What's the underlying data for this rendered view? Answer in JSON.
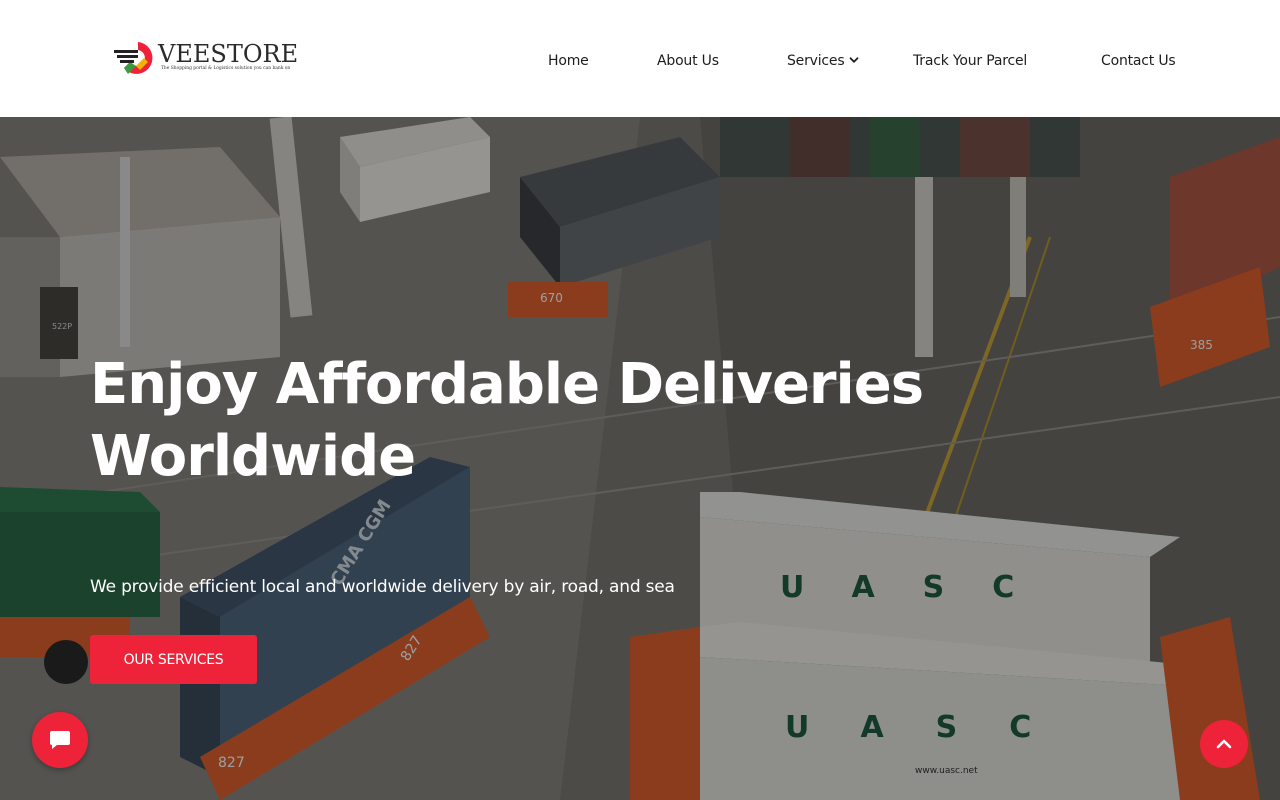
{
  "brand": {
    "name": "VEESTORE",
    "tagline": "The Shopping portal & Logistics solution you can bank on",
    "colors": {
      "red": "#ee2239",
      "dark": "#2b2b2b",
      "green": "#3c9a3c",
      "yellow": "#f2b400"
    }
  },
  "nav": {
    "home": "Home",
    "about": "About Us",
    "services": "Services",
    "track": "Track Your Parcel",
    "contact": "Contact Us"
  },
  "hero": {
    "title_line1": "Enjoy Affordable Deliveries",
    "title_line2": "Worldwide",
    "subtitle": "We provide efficient local and worldwide delivery by air, road, and sea",
    "button": "OUR SERVICES",
    "photo_labels": {
      "container_top": "UASC",
      "container_bottom": "UASC",
      "cma": "CMA CGM",
      "website": "www.uasc.net",
      "num_670": "670",
      "num_385": "385",
      "num_827a": "827",
      "num_827b": "827",
      "num_522": "522P"
    }
  },
  "icons": {
    "chat": "chat-bubble-icon",
    "back_to_top": "chevron-up-icon",
    "dropdown": "chevron-down-icon"
  }
}
